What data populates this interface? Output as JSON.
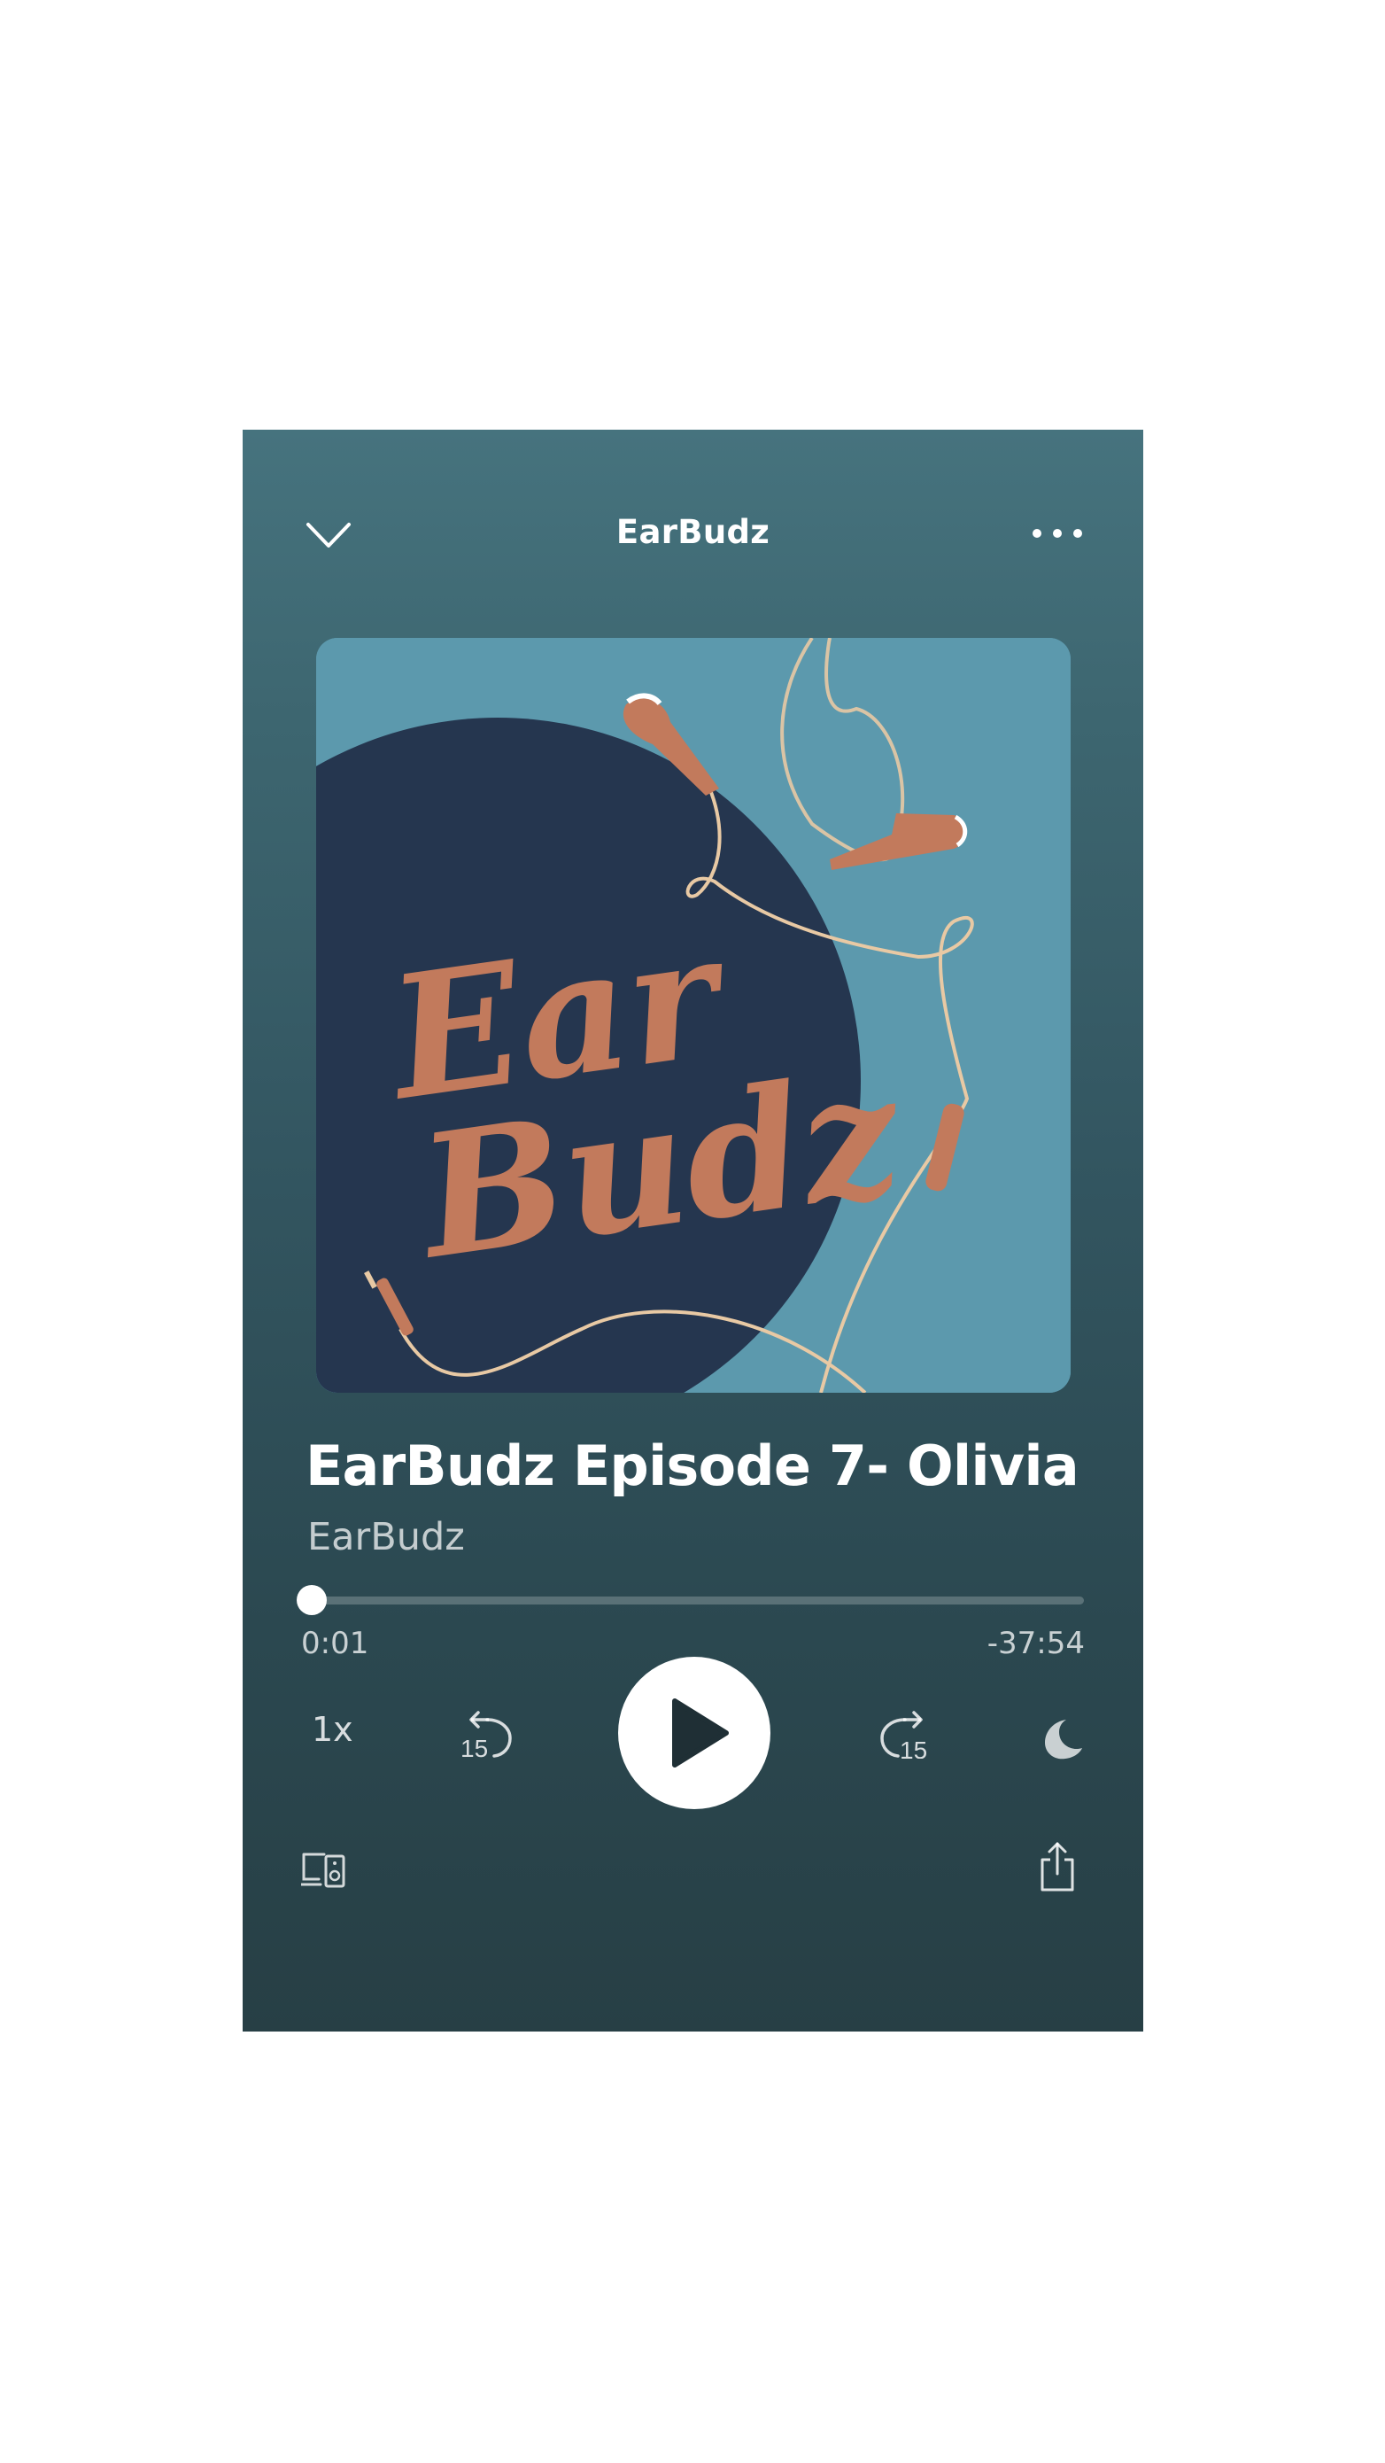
{
  "header": {
    "title": "EarBudz",
    "collapse_icon": "chevron-down-icon",
    "more_icon": "more-horizontal-icon"
  },
  "artwork": {
    "text_line1": "Ear",
    "text_line2": "Budz",
    "colors": {
      "background": "#5c99ad",
      "circle": "#25364f",
      "accent": "#c27a5c",
      "cord": "#e8c9a4"
    }
  },
  "episode": {
    "title": "EarBudz Episode 7- Olivia",
    "show": "EarBudz"
  },
  "progress": {
    "elapsed": "0:01",
    "remaining": "-37:54",
    "fraction": 0.0004
  },
  "controls": {
    "speed_label": "1x",
    "skip_back_label": "15",
    "skip_forward_label": "15",
    "play_icon": "play-icon",
    "sleep_icon": "moon-icon",
    "devices_icon": "connect-devices-icon",
    "share_icon": "share-icon"
  },
  "colors": {
    "gradient_top": "#46737e",
    "gradient_bottom": "#273f45",
    "primary_text": "#ffffff"
  }
}
